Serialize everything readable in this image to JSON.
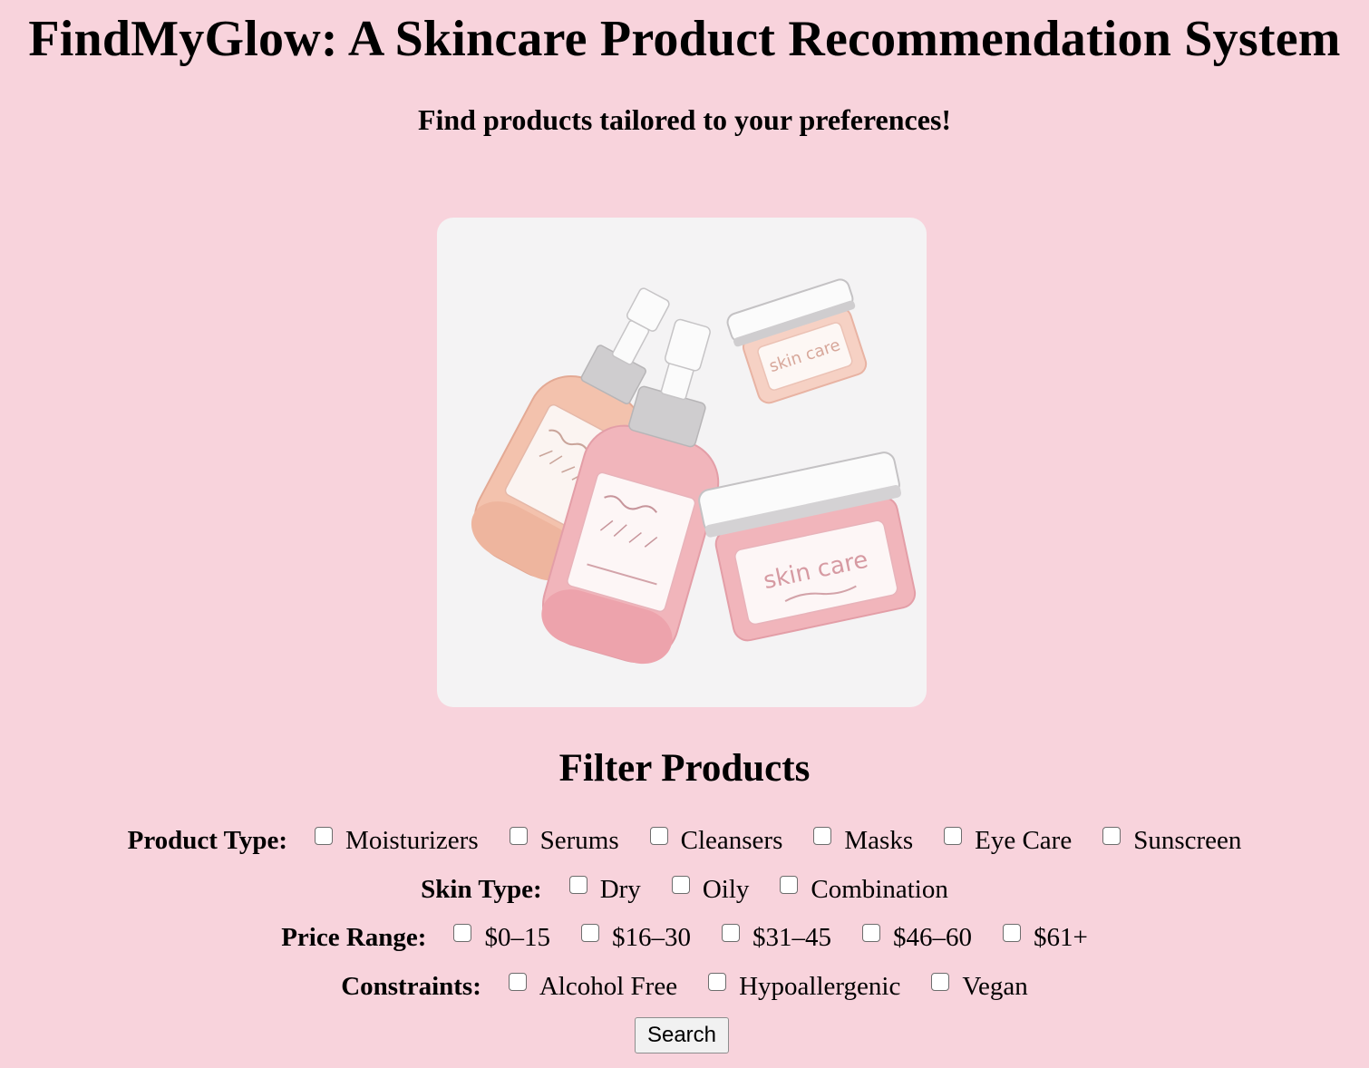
{
  "header": {
    "title": "FindMyGlow: A Skincare Product Recommendation System",
    "subtitle": "Find products tailored to your preferences!"
  },
  "hero": {
    "jar_label": "skin care",
    "colors": {
      "peach": "#f3c2ad",
      "pink": "#f1b5bb",
      "cap": "#cfcdcf",
      "card": "#f4f3f4"
    }
  },
  "filters": {
    "heading": "Filter Products",
    "product_type": {
      "label": "Product Type:",
      "options": [
        "Moisturizers",
        "Serums",
        "Cleansers",
        "Masks",
        "Eye Care",
        "Sunscreen"
      ]
    },
    "skin_type": {
      "label": "Skin Type:",
      "options": [
        "Dry",
        "Oily",
        "Combination"
      ]
    },
    "price_range": {
      "label": "Price Range:",
      "options": [
        "$0–15",
        "$16–30",
        "$31–45",
        "$46–60",
        "$61+"
      ]
    },
    "constraints": {
      "label": "Constraints:",
      "options": [
        "Alcohol Free",
        "Hypoallergenic",
        "Vegan"
      ]
    },
    "search_label": "Search"
  },
  "theme": {
    "background": "#f8d3dc"
  }
}
